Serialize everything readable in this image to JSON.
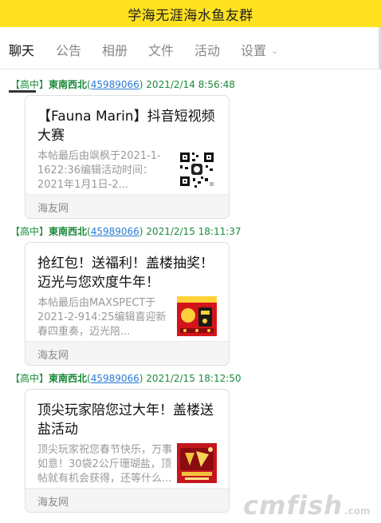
{
  "app_title": "学海无涯海水鱼友群",
  "tabs": [
    {
      "label": "聊天"
    },
    {
      "label": "公告"
    },
    {
      "label": "相册"
    },
    {
      "label": "文件"
    },
    {
      "label": "活动"
    },
    {
      "label": "设置"
    }
  ],
  "posts": [
    {
      "tag": "【高中】",
      "author": "東南西北",
      "qq": "45989066",
      "time": "2021/2/14 8:56:48",
      "title": "【Fauna Marin】抖音短视频大赛",
      "desc": "本帖最后由飒枫于2021-1-1622:36编辑活动时间：2021年1月1日-2...",
      "source": "海友网",
      "thumb_icon": "qr-code-thumbnail"
    },
    {
      "tag": "【高中】",
      "author": "東南西北",
      "qq": "45989066",
      "time": "2021/2/15 18:11:37",
      "title": "抢红包！送福利！盖楼抽奖！迈光与您欢度牛年！",
      "desc": "本帖最后由MAXSPECT于2021-2-914:25编辑喜迎新春四重奏，迈光陪...",
      "source": "海友网",
      "thumb_icon": "red-envelope-thumbnail"
    },
    {
      "tag": "【高中】",
      "author": "東南西北",
      "qq": "45989066",
      "time": "2021/2/15 18:12:50",
      "title": "顶尖玩家陪您过大年！盖楼送盐活动",
      "desc": "顶尖玩家祝您春节快乐，万事如意！30袋2公斤珊瑚盐，顶帖就有机会获得，还等什么...",
      "source": "海友网",
      "thumb_icon": "new-year-poster-thumbnail"
    }
  ],
  "watermark": {
    "main": "cmfish",
    "suffix": ".com"
  },
  "colors": {
    "topbar": "#ffe11f",
    "author_green": "#1a8a3a",
    "link_blue": "#2b7bd6"
  }
}
